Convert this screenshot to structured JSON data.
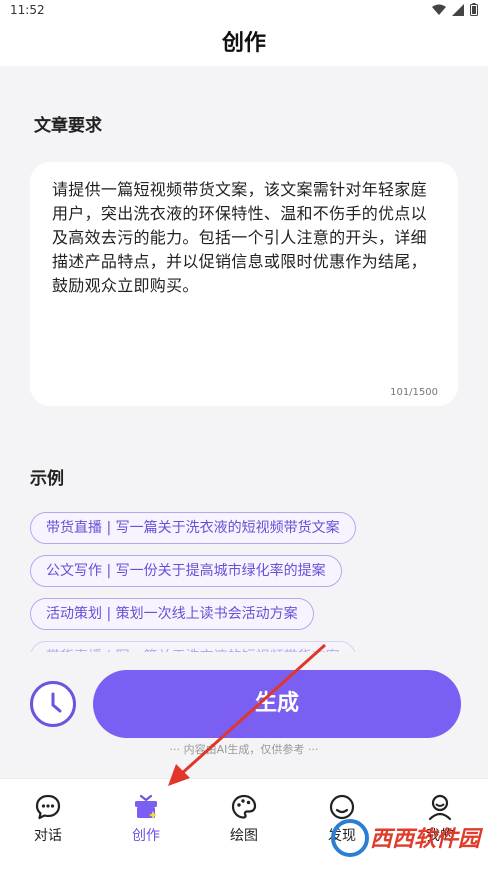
{
  "status_bar": {
    "time": "11:52"
  },
  "header": {
    "title": "创作"
  },
  "article": {
    "section_title": "文章要求",
    "text": "请提供一篇短视频带货文案，该文案需针对年轻家庭用户，突出洗衣液的环保特性、温和不伤手的优点以及高效去污的能力。包括一个引人注意的开头，详细描述产品特点，并以促销信息或限时优惠作为结尾，鼓励观众立即购买。",
    "counter": "101/1500"
  },
  "examples": {
    "section_title": "示例",
    "items": [
      "带货直播 | 写一篇关于洗衣液的短视频带货文案",
      "公文写作 | 写一份关于提高城市绿化率的提案",
      "活动策划 | 策划一次线上读书会活动方案",
      "带货直播 | 写一篇关于洗衣液的短视频带货文案"
    ]
  },
  "actions": {
    "generate_label": "生成",
    "disclaimer": "··· 内容由AI生成，仅供参考 ···"
  },
  "tabs": [
    {
      "label": "对话",
      "icon": "chat-icon"
    },
    {
      "label": "创作",
      "icon": "gift-box-icon",
      "active": true
    },
    {
      "label": "绘图",
      "icon": "palette-icon"
    },
    {
      "label": "发现",
      "icon": "compass-icon"
    },
    {
      "label": "我的",
      "icon": "user-icon"
    }
  ],
  "watermark": {
    "text": "西西软件园"
  },
  "colors": {
    "accent": "#7b5ef2",
    "background": "#f4f4f6",
    "annotation_arrow": "#e0362c"
  }
}
